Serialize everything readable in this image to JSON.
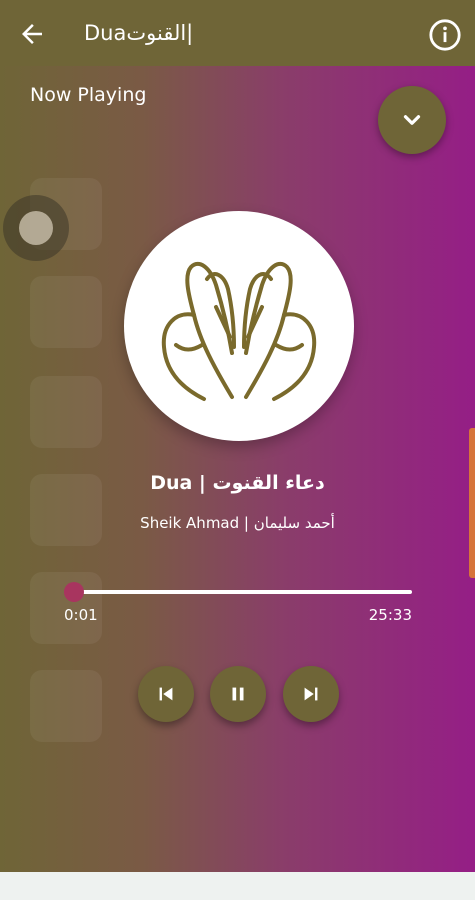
{
  "app_bar": {
    "title": "Duaالقنوت|",
    "back_icon": "arrow-left-icon",
    "info_icon": "info-icon",
    "background": "#6f6537"
  },
  "player": {
    "now_playing_label": "Now Playing",
    "collapse_icon": "chevron-down-icon",
    "artwork_icon": "praying-hands-icon",
    "track_title": "Dua | دعاء القنوت",
    "track_artist": "Sheik Ahmad | أحمد سليمان",
    "elapsed": "0:01",
    "duration": "25:33",
    "progress_fraction": 0.0007,
    "controls": {
      "previous_icon": "skip-previous-icon",
      "pause_icon": "pause-icon",
      "next_icon": "skip-next-icon"
    },
    "colors": {
      "accent": "#6f6537",
      "gradient_end": "#951e86",
      "seek_thumb": "#a8355f"
    }
  }
}
